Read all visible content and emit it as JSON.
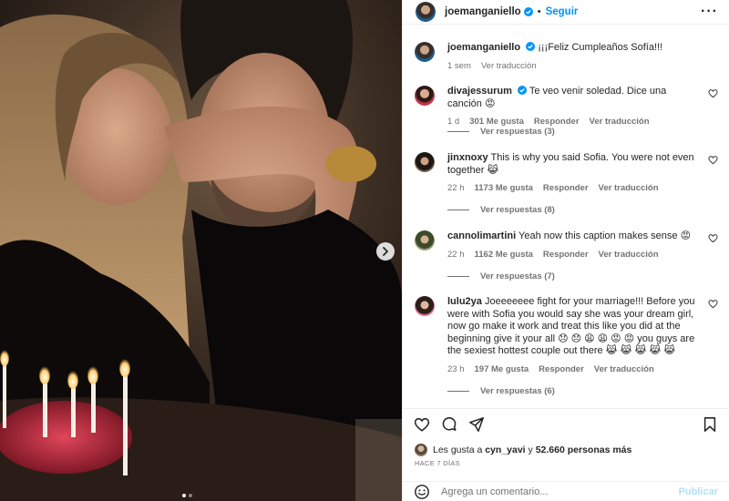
{
  "post": {
    "username": "joemanganiello",
    "follow_label": "Seguir",
    "separator": "•",
    "caption": "¡¡¡Feliz Cumpleaños Sofía!!!",
    "caption_time": "1 sem",
    "caption_translate": "Ver traducción",
    "image_description": "couple-photo"
  },
  "comments": [
    {
      "username": "divajessurum",
      "text": "Te veo venir soledad. Dice una canción 😡",
      "time": "1 d",
      "likes": "301 Me gusta",
      "reply": "Responder",
      "translate": "Ver traducción",
      "replies": "Ver respuestas (3)"
    },
    {
      "username": "jinxnoxy",
      "text": "This is why you said Sofia. You were not even together 😹",
      "time": "22 h",
      "likes": "1173 Me gusta",
      "reply": "Responder",
      "translate": "Ver traducción",
      "replies": "Ver respuestas (8)"
    },
    {
      "username": "cannolimartini",
      "text": "Yeah now this caption makes sense 😡",
      "time": "22 h",
      "likes": "1162 Me gusta",
      "reply": "Responder",
      "translate": "Ver traducción",
      "replies": "Ver respuestas (7)"
    },
    {
      "username": "lulu2ya",
      "text": "Joeeeeeee fight for your marriage!!! Before you were with Sofia you would say she was your dream girl, now go make it work and treat this like you did at the beginning give it your all 😞 😞 😩 😩 😡 😡 you guys are the sexiest hottest couple out there 😹 😹 😹 😹 😹",
      "time": "23 h",
      "likes": "197 Me gusta",
      "reply": "Responder",
      "translate": "Ver traducción",
      "replies": "Ver respuestas (6)"
    }
  ],
  "likes_summary": {
    "prefix": "Les gusta a",
    "user": "cyn_yavi",
    "conj": "y",
    "others": "52.660 personas más"
  },
  "time_ago": "HACE 7 DÍAS",
  "add_comment": {
    "placeholder": "Agrega un comentario...",
    "publish": "Publicar"
  },
  "icons": {
    "verified": "verified-badge-icon",
    "more": "more-options-icon",
    "heart": "heart-icon",
    "comment": "comment-icon",
    "share": "share-icon",
    "save": "bookmark-icon",
    "emoji": "emoji-icon",
    "next": "chevron-right-icon"
  },
  "colors": {
    "accent": "#0095f6",
    "verified": "#0095f6",
    "publish_disabled": "#b2dffc",
    "muted": "#737373"
  },
  "carousel": {
    "slides": 2,
    "active": 1
  }
}
